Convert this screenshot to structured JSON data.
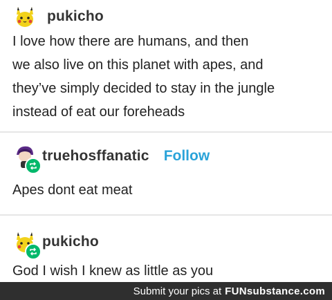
{
  "posts": [
    {
      "username": "pukicho",
      "avatar_icon": "pikachu-avatar-icon",
      "text": "I love how there are humans, and then\nwe also live on this planet with apes, and\nthey’ve simply decided to stay in the jungle\ninstead of eat our foreheads"
    },
    {
      "username": "truehosffanatic",
      "avatar_icon": "purple-character-avatar-icon",
      "follow_label": "Follow",
      "badge_icon": "reblog-icon",
      "text": "Apes dont eat meat"
    },
    {
      "username": "pukicho",
      "avatar_icon": "pikachu-avatar-icon",
      "badge_icon": "reblog-icon",
      "text": "God I wish I knew as little as you"
    }
  ],
  "watermark": {
    "prefix": "Submit your pics at",
    "brand": "FUNsubstance.com"
  },
  "colors": {
    "follow": "#2aa3d9",
    "reblog_badge": "#00b86b",
    "watermark_bg": "#2f2f2f"
  }
}
